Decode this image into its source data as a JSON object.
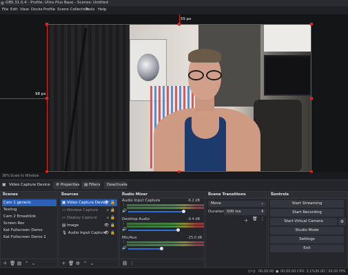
{
  "window": {
    "title": "OBS 31.0.4 - Profile: Ultra Plus Base - Scenes: Untitled"
  },
  "menu": [
    "File",
    "Edit",
    "View",
    "Docks",
    "Profile",
    "Scene Collection",
    "Tools",
    "Help"
  ],
  "preview": {
    "top_dim_label": "55 px",
    "left_dim_label": "98 px"
  },
  "zoom": {
    "percent": "38%",
    "mode": "Scale to Window"
  },
  "source_toolbar": {
    "selected_source": "Video Capture Device",
    "properties_label": "Properties",
    "filters_label": "Filters",
    "deactivate_label": "Deactivate"
  },
  "scenes": {
    "title": "Scenes",
    "items": [
      "Cam 1 generic",
      "Testing",
      "Cam 2 Emeetlink",
      "Screen Rec",
      "Kat Fullscreen Demo",
      "Kat Fullscreen Demo 2"
    ],
    "selected_index": 0
  },
  "sources": {
    "title": "Sources",
    "items": [
      "Video Capture Device",
      "Window Capture",
      "Display Capture",
      "Image",
      "Audio Input Capture"
    ],
    "selected_index": 0,
    "hidden": [
      1,
      2
    ]
  },
  "mixer": {
    "title": "Audio Mixer",
    "channels": [
      {
        "name": "Audio Input Capture",
        "db": "-6.2 dB",
        "level": 0.75
      },
      {
        "name": "Desktop Audio",
        "db": "-9.4 dB",
        "level": 0.68
      },
      {
        "name": "Mic/Aux",
        "db": "-25.0 dB",
        "level": 0.45
      }
    ]
  },
  "transitions": {
    "title": "Scene Transitions",
    "selected": "Move",
    "duration_label": "Duration",
    "duration_value": "500 ms"
  },
  "controls": {
    "title": "Controls",
    "buttons": [
      "Start Streaming",
      "Start Recording",
      "Start Virtual Camera",
      "Studio Mode",
      "Settings",
      "Exit"
    ]
  },
  "status": {
    "live": "00:00:00",
    "rec": "00:00:00",
    "cpu": "CPU: 3.1%",
    "fps": "30.00 / 30.00 FPS"
  },
  "colors": {
    "accent": "#2c5fb8",
    "selection": "#e02424"
  }
}
